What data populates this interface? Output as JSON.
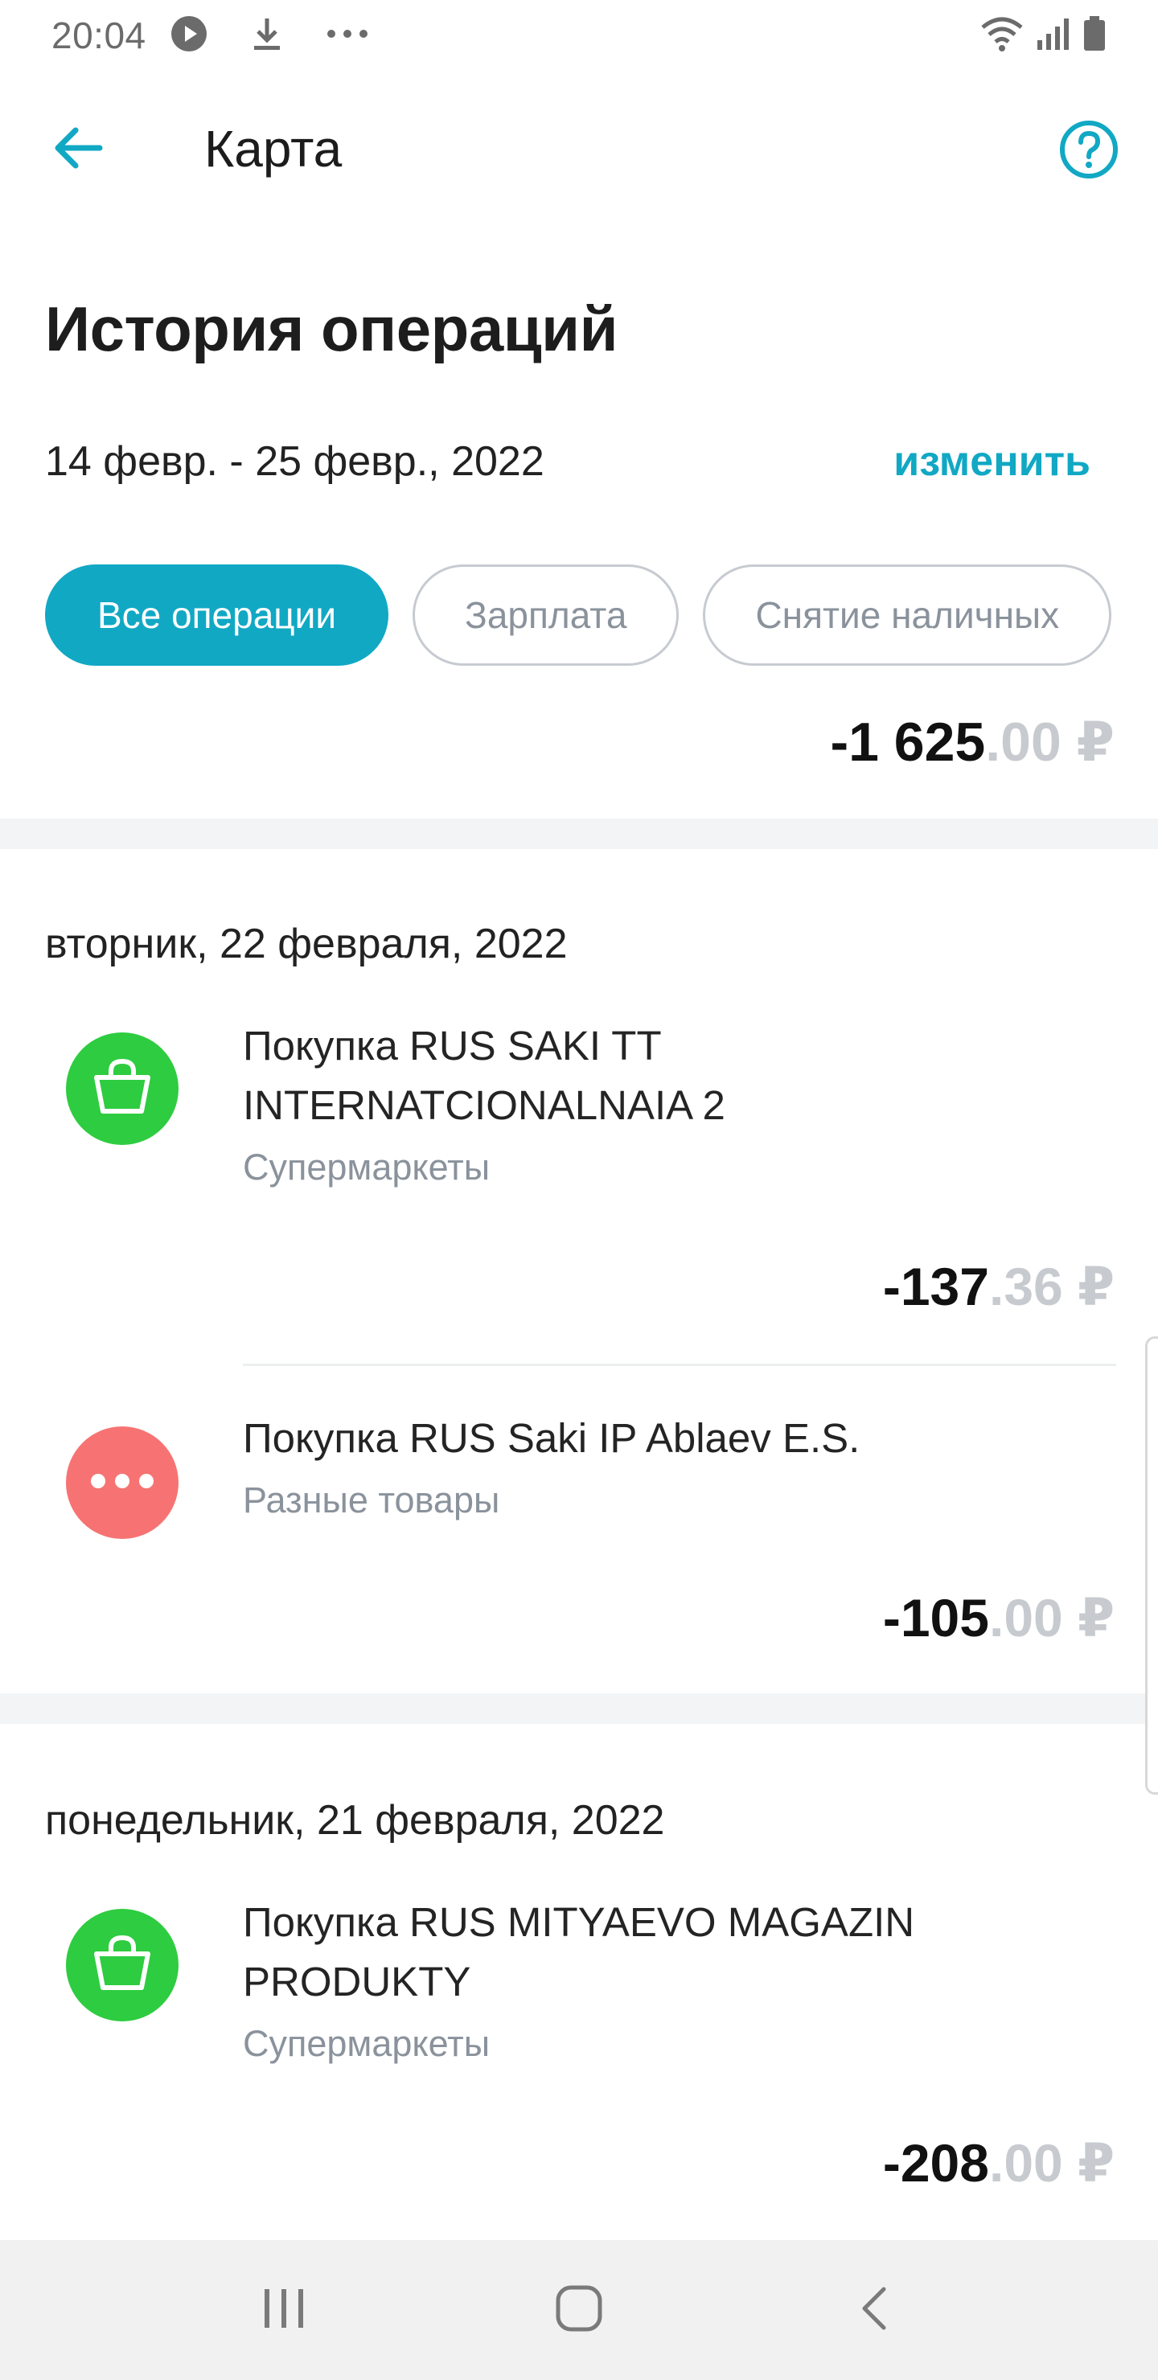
{
  "status_bar": {
    "time": "20:04",
    "icons": [
      "play-circle-icon",
      "download-icon",
      "more-dots-icon",
      "wifi-icon",
      "signal-icon",
      "battery-icon"
    ]
  },
  "appbar": {
    "title": "Карта",
    "back_icon": "arrow-left-icon",
    "help_icon": "help-circle-icon"
  },
  "page": {
    "title": "История операций",
    "period": "14 февр. - 25 февр., 2022",
    "change_label": "изменить"
  },
  "filters": [
    {
      "label": "Все операции",
      "active": true
    },
    {
      "label": "Зарплата",
      "active": false
    },
    {
      "label": "Снятие наличных",
      "active": false
    }
  ],
  "total": {
    "main": "-1 625",
    "decimals": ".00 ₽"
  },
  "groups": [
    {
      "date": "вторник, 22 февраля, 2022",
      "transactions": [
        {
          "title_line1": "Покупка RUS SAKI TT",
          "title_line2": "INTERNATCIONALNAIA 2",
          "category": "Супермаркеты",
          "icon": "shopping-bag-icon",
          "amount_main": "-137",
          "amount_dec": ".36 ₽"
        },
        {
          "title_line1": "Покупка RUS Saki IP Ablaev E.S.",
          "title_line2": "",
          "category": "Разные товары",
          "icon": "more-dots-icon",
          "amount_main": "-105",
          "amount_dec": ".00 ₽"
        }
      ]
    },
    {
      "date": "понедельник, 21 февраля, 2022",
      "transactions": [
        {
          "title_line1": "Покупка RUS MITYAEVO MAGAZIN",
          "title_line2": "PRODUKTY",
          "category": "Супермаркеты",
          "icon": "shopping-bag-icon",
          "amount_main": "-208",
          "amount_dec": ".00 ₽"
        }
      ]
    }
  ],
  "colors": {
    "accent": "#11a8c4",
    "green_icon": "#2ecc40",
    "red_icon": "#f77373",
    "muted_text": "#8a929c",
    "decimal_gray": "#c7cbcf"
  },
  "navbar": {
    "icons": [
      "recent-apps-icon",
      "home-icon",
      "back-icon"
    ]
  }
}
